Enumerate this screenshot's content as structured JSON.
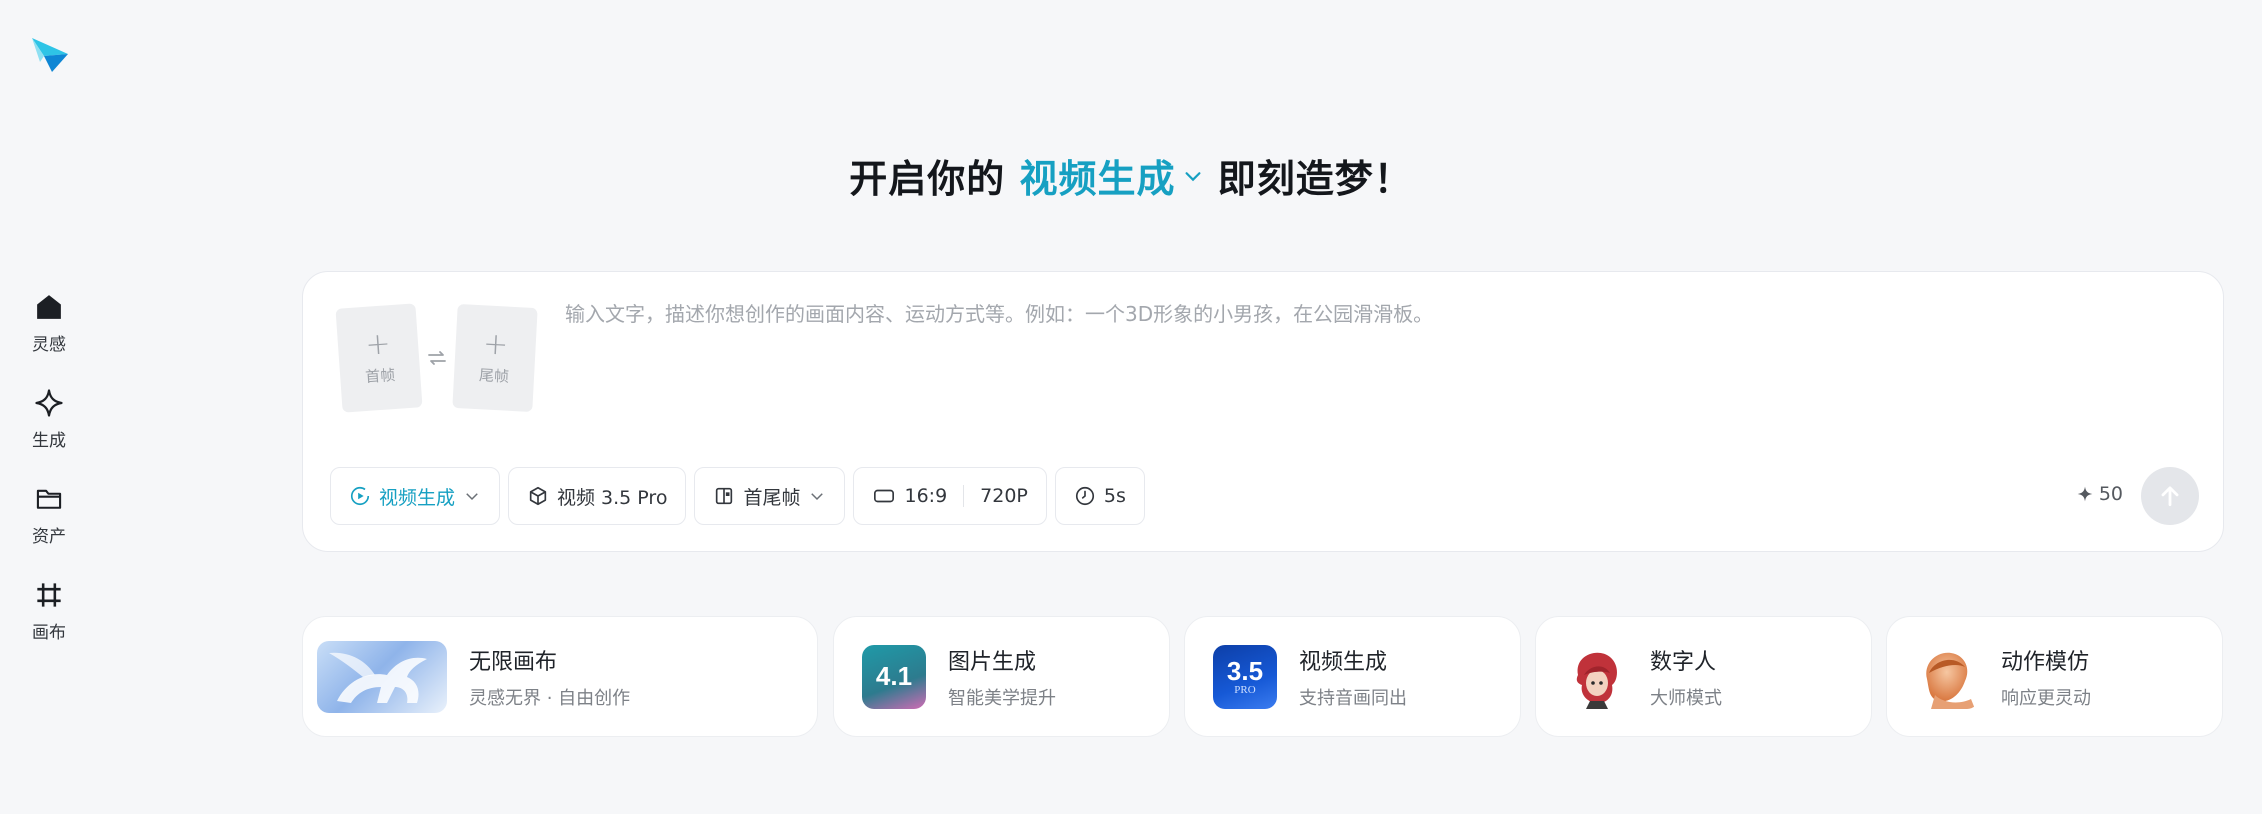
{
  "colors": {
    "accent": "#16a0c2",
    "background": "#f6f7f9"
  },
  "logo": {
    "icon": "paper-plane-logo"
  },
  "sidebar": {
    "items": [
      {
        "label": "灵感",
        "icon": "home-icon"
      },
      {
        "label": "生成",
        "icon": "diamond-sparkle-icon"
      },
      {
        "label": "资产",
        "icon": "folder-icon"
      },
      {
        "label": "画布",
        "icon": "crop-frame-icon"
      }
    ]
  },
  "headline": {
    "prefix": "开启你的",
    "mode": "视频生成",
    "suffix": "即刻造梦！"
  },
  "composer": {
    "first_frame_label": "首帧",
    "last_frame_label": "尾帧",
    "placeholder": "输入文字，描述你想创作的画面内容、运动方式等。例如：一个3D形象的小男孩，在公园滑滑板。",
    "mode_chip": "视频生成",
    "model_chip": "视频 3.5 Pro",
    "frame_chip": "首尾帧",
    "ratio": "16:9",
    "resolution": "720P",
    "duration": "5s",
    "credits": "50"
  },
  "cards": [
    {
      "title": "无限画布",
      "subtitle": "灵感无界 · 自由创作",
      "icon": "pegasus-thumbnail"
    },
    {
      "title": "图片生成",
      "subtitle": "智能美学提升",
      "badge": "4.1",
      "icon": "image-model-thumbnail"
    },
    {
      "title": "视频生成",
      "subtitle": "支持音画同出",
      "badge": "3.5",
      "badge_sub": "PRO",
      "icon": "video-model-thumbnail"
    },
    {
      "title": "数字人",
      "subtitle": "大师模式",
      "icon": "avatar-thumbnail"
    },
    {
      "title": "动作模仿",
      "subtitle": "响应更灵动",
      "icon": "motion-thumbnail"
    }
  ]
}
